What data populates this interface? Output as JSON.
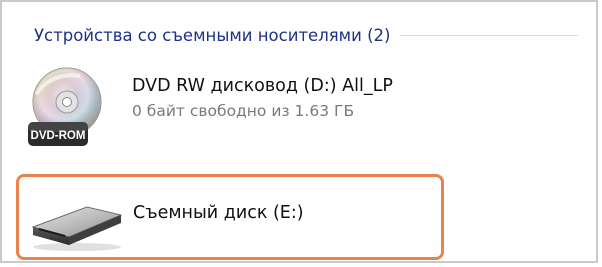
{
  "group": {
    "title": "Устройства со съемными носителями (2)"
  },
  "devices": [
    {
      "name": "DVD RW дисковод (D:) All_LP",
      "subtext": "0 байт свободно из 1.63 ГБ",
      "icon": "dvd-rom-icon",
      "icon_badge": "DVD-ROM"
    },
    {
      "name": "Съемный диск (E:)",
      "icon": "removable-disk-icon",
      "selected_highlight": "#e8834f"
    }
  ]
}
